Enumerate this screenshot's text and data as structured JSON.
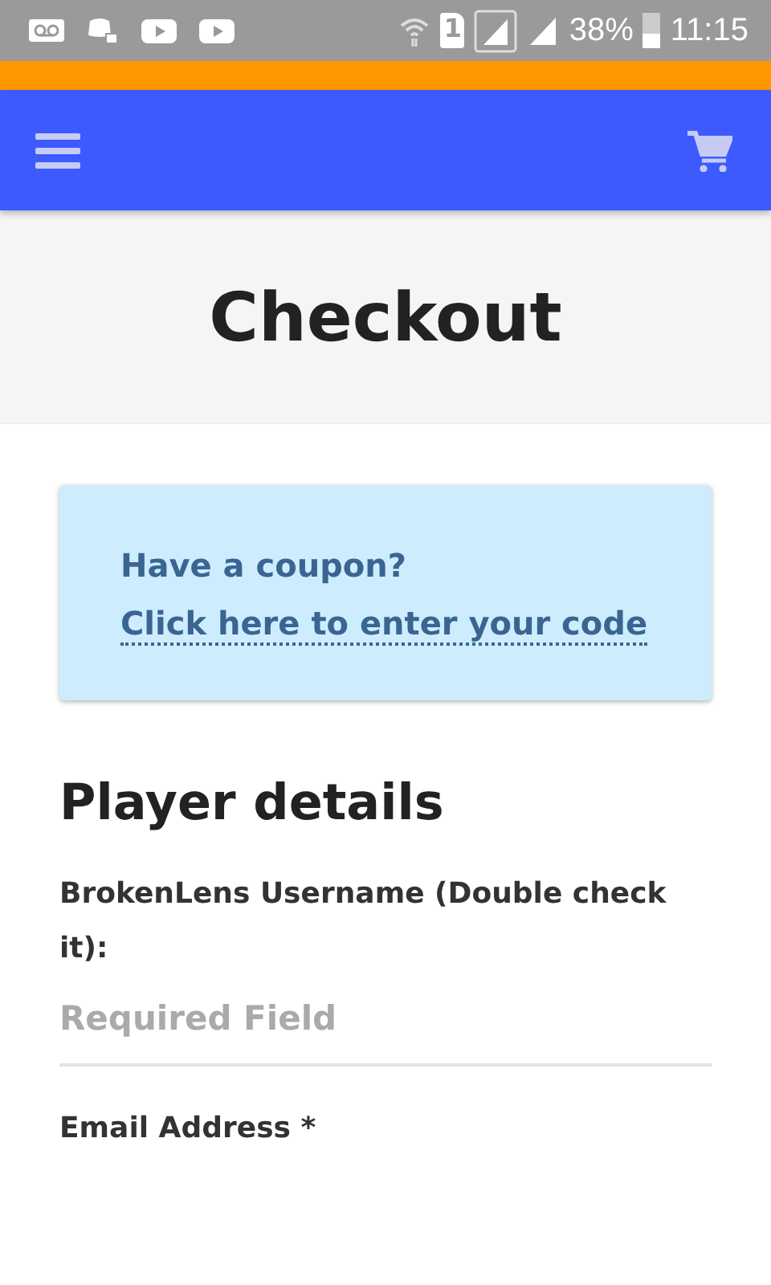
{
  "status_bar": {
    "sim": "1",
    "battery": "38%",
    "time": "11:15"
  },
  "page_title": "Checkout",
  "coupon": {
    "text": "Have a coupon?",
    "link": "Click here to enter your code"
  },
  "section_title": "Player details",
  "fields": [
    {
      "label": "BrokenLens Username (Double check it):",
      "placeholder": "Required Field"
    },
    {
      "label": "Email Address *"
    }
  ]
}
